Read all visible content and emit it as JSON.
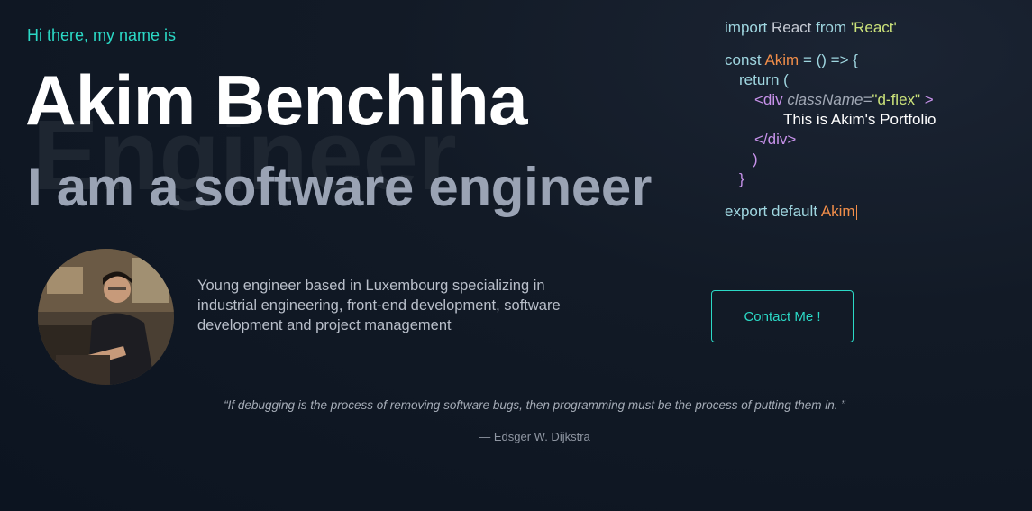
{
  "hero": {
    "greeting": "Hi there, my name is",
    "name": "Akim Benchiha",
    "background_word": "Engineer",
    "subtitle": "I am a software engineer"
  },
  "code": {
    "l1_import": "import",
    "l1_react": "React",
    "l1_from": "from",
    "l1_module": "'React'",
    "l2_const": "const",
    "l2_name": "Akim",
    "l2_eq": "= () => {",
    "l3_return": "return (",
    "l4_open": "<div",
    "l4_attr": "className=",
    "l4_val": "\"d-flex\"",
    "l4_close": ">",
    "l5_text": "This is Akim's Portfolio",
    "l6_close": "</div>",
    "l7_paren": ")",
    "l8_brace": "}",
    "l9_export": "export default",
    "l9_name": "Akim"
  },
  "profile": {
    "avatar_icon": "profile-photo",
    "bio": "Young engineer based in Luxembourg specializing in industrial engineering, front-end development, software development and project management"
  },
  "cta": {
    "contact_label": "Contact Me !"
  },
  "quote": {
    "text": "“If debugging is the process of removing software bugs, then programming must be the process of putting them in. ”",
    "author": "— Edsger W. Dijkstra"
  },
  "colors": {
    "accent": "#2bd9c6",
    "background": "#121a26",
    "code_orange": "#f08d49",
    "code_green": "#cbe27a",
    "code_purple": "#c792ea"
  }
}
